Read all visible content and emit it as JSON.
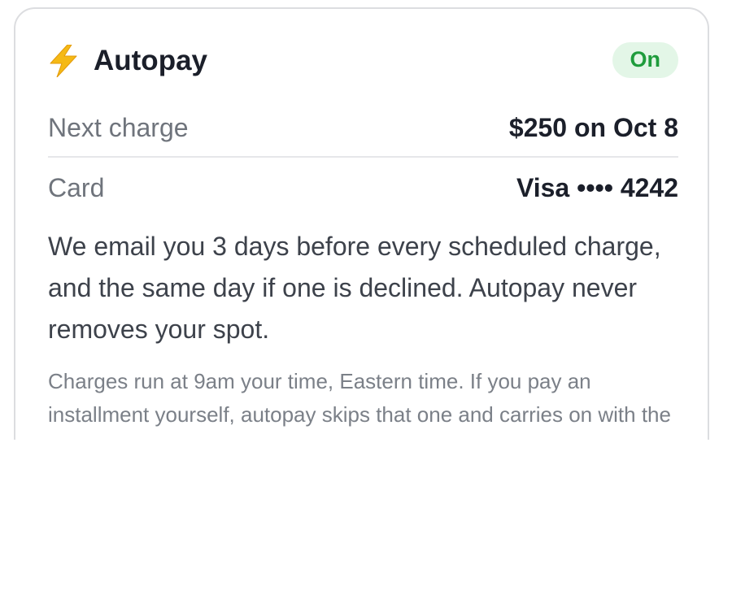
{
  "card": {
    "title": "Autopay",
    "icon": "lightning-bolt-icon",
    "status": "On",
    "status_color": "#1f9c3c",
    "rows": [
      {
        "label": "Next charge",
        "value": "$250 on Oct 8"
      },
      {
        "label": "Card",
        "value": "Visa •••• 4242"
      }
    ],
    "description": "We email you 3 days before every scheduled charge, and the same day if one is declined. Autopay never removes your spot.",
    "fine_print": "Charges run at 9am your time, Eastern time. If you pay an installment yourself, autopay skips that one and carries on with the next."
  }
}
